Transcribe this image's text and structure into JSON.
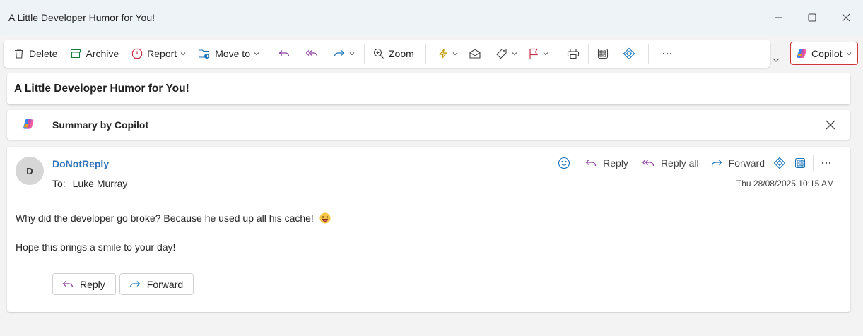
{
  "window": {
    "title": "A Little Developer Humor for You!",
    "controls": [
      "minimize-icon",
      "maximize-icon",
      "close-icon"
    ]
  },
  "toolbar": {
    "delete_label": "Delete",
    "archive_label": "Archive",
    "report_label": "Report",
    "moveto_label": "Move to",
    "zoom_label": "Zoom",
    "copilot_label": "Copilot"
  },
  "subject": "A Little Developer Humor for You!",
  "summary": {
    "label": "Summary by Copilot"
  },
  "message": {
    "avatar_initial": "D",
    "sender": "DoNotReply",
    "to_prefix": "To:",
    "to_name": "Luke Murray",
    "date": "Thu 28/08/2025 10:15 AM",
    "actions": {
      "reply": "Reply",
      "reply_all": "Reply all",
      "forward": "Forward"
    },
    "body": [
      "Why did the developer go broke? Because he used up all his cache!",
      "Hope this brings a smile to your day!"
    ],
    "bottom_buttons": {
      "reply": "Reply",
      "forward": "Forward"
    }
  },
  "colors": {
    "accent_blue": "#2f72b5",
    "reply_purple": "#8a3c9e",
    "forward_blue": "#1a73b8",
    "flag_red": "#c4314b",
    "quick_step_yellow": "#c19c00",
    "copilot_border": "#d13438"
  }
}
